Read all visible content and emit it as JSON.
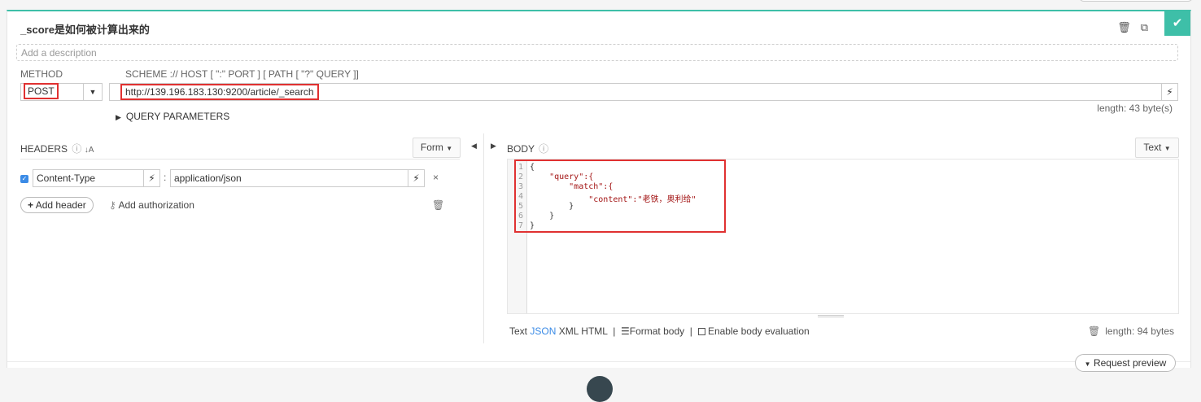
{
  "request": {
    "title": "_score是如何被计算出来的",
    "description_placeholder": "Add a description",
    "method_label": "METHOD",
    "method": "POST",
    "url_scheme_label": "SCHEME :// HOST [ \":\" PORT ] [ PATH [ \"?\" QUERY ]]",
    "url": "http://139.196.183.130:9200/article/_search",
    "url_length": "length: 43 byte(s)",
    "query_parameters_label": "QUERY PARAMETERS"
  },
  "headers": {
    "label": "HEADERS",
    "form_button": "Form",
    "items": [
      {
        "name": "Content-Type",
        "value": "application/json",
        "enabled": true
      }
    ],
    "add_header": "Add header",
    "add_authorization": "Add authorization"
  },
  "body": {
    "label": "BODY",
    "text_button": "Text",
    "lines": [
      "1",
      "2",
      "3",
      "4",
      "5",
      "6",
      "7"
    ],
    "code": [
      "{",
      "    \"query\":{",
      "        \"match\":{",
      "            \"content\":\"老铁，奥利给\"",
      "        }",
      "    }",
      "}"
    ],
    "formats": [
      "Text",
      "JSON",
      "XML",
      "HTML"
    ],
    "active_format": "JSON",
    "separator": "|",
    "format_body": "Format body",
    "enable_eval": "Enable body evaluation",
    "length": "length: 94 bytes"
  },
  "footer": {
    "request_preview": "Request preview"
  },
  "colors": {
    "accent": "#3ebfa8",
    "highlight": "#e03131",
    "link": "#3b8be6"
  },
  "icons": [
    "check-icon",
    "trash-icon",
    "copy-icon",
    "magic-wand-icon",
    "caret-right-icon",
    "caret-left-icon",
    "help-icon",
    "sort-alpha-icon",
    "plus-icon",
    "key-icon",
    "close-icon",
    "format-lines-icon",
    "caret-down-icon"
  ]
}
